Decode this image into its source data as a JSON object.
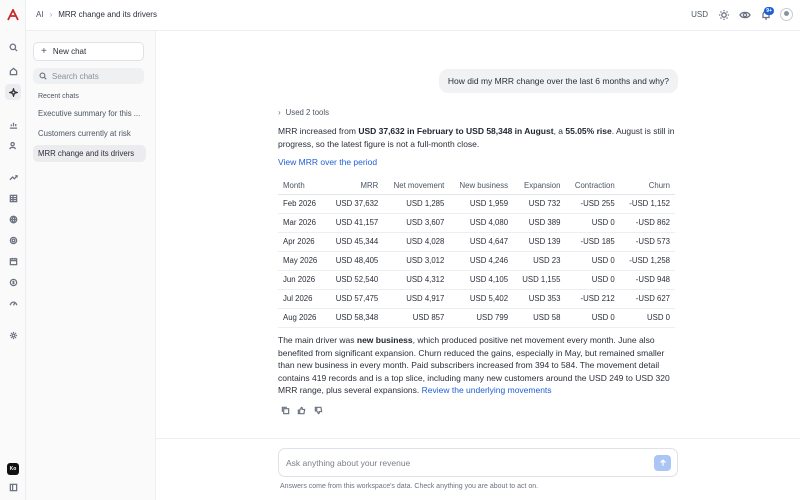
{
  "header": {
    "breadcrumb_root": "AI",
    "breadcrumb_sep": "›",
    "breadcrumb_current": "MRR change and its drivers",
    "currency": "USD",
    "notification_count": "9+"
  },
  "rail": {
    "icons": [
      "search-icon",
      "home-icon",
      "ai-sparkle-icon",
      "chart-icon",
      "users-icon",
      "trend-icon",
      "table-icon",
      "globe-icon",
      "gear-outline-icon",
      "calendar-icon",
      "receipt-icon",
      "gauge-icon",
      "settings-icon"
    ],
    "brand": "Ko"
  },
  "sidebar": {
    "new_chat": "New chat",
    "search_placeholder": "Search chats",
    "recent_heading": "Recent chats",
    "chats": [
      {
        "label": "Executive summary for this ..."
      },
      {
        "label": "Customers currently at risk"
      },
      {
        "label": "MRR change and its drivers"
      }
    ]
  },
  "conversation": {
    "user_message": "How did my MRR change over the last 6 months and why?",
    "used_tools": "Used 2 tools",
    "summary": {
      "p1": "MRR increased from ",
      "b1": "USD 37,632 in February to USD 58,348 in August",
      "p2": ", a ",
      "b2": "55.05% rise",
      "p3": ". August is still in progress, so the latest figure is not a full-month close."
    },
    "view_link": "View MRR over the period",
    "table": {
      "headers": [
        "Month",
        "MRR",
        "Net movement",
        "New business",
        "Expansion",
        "Contraction",
        "Churn"
      ],
      "rows": [
        [
          "Feb 2026",
          "USD 37,632",
          "USD 1,285",
          "USD 1,959",
          "USD 732",
          "-USD 255",
          "-USD 1,152"
        ],
        [
          "Mar 2026",
          "USD 41,157",
          "USD 3,607",
          "USD 4,080",
          "USD 389",
          "USD 0",
          "-USD 862"
        ],
        [
          "Apr 2026",
          "USD 45,344",
          "USD 4,028",
          "USD 4,647",
          "USD 139",
          "-USD 185",
          "-USD 573"
        ],
        [
          "May 2026",
          "USD 48,405",
          "USD 3,012",
          "USD 4,246",
          "USD 23",
          "USD 0",
          "-USD 1,258"
        ],
        [
          "Jun 2026",
          "USD 52,540",
          "USD 4,312",
          "USD 4,105",
          "USD 1,155",
          "USD 0",
          "-USD 948"
        ],
        [
          "Jul 2026",
          "USD 57,475",
          "USD 4,917",
          "USD 5,402",
          "USD 353",
          "-USD 212",
          "-USD 627"
        ],
        [
          "Aug 2026",
          "USD 58,348",
          "USD 857",
          "USD 799",
          "USD 58",
          "USD 0",
          "USD 0"
        ]
      ]
    },
    "drivers": {
      "p1": "The main driver was ",
      "b1": "new business",
      "p2": ", which produced positive net movement every month. June also benefited from significant expansion. Churn reduced the gains, especially in May, but remained smaller than new business in every month. Paid subscribers increased from 394 to 584. The movement detail contains 419 records and is a top slice, including many new customers around the USD 249 to USD 320 MRR range, plus several expansions. ",
      "link": "Review the underlying movements"
    }
  },
  "composer": {
    "placeholder": "Ask anything about your revenue",
    "disclaimer": "Answers come from this workspace's data. Check anything you are about to act on."
  },
  "colors": {
    "accent": "#1f5fd6",
    "brand_red": "#c62b2b",
    "send_button": "#a9c6f5"
  }
}
